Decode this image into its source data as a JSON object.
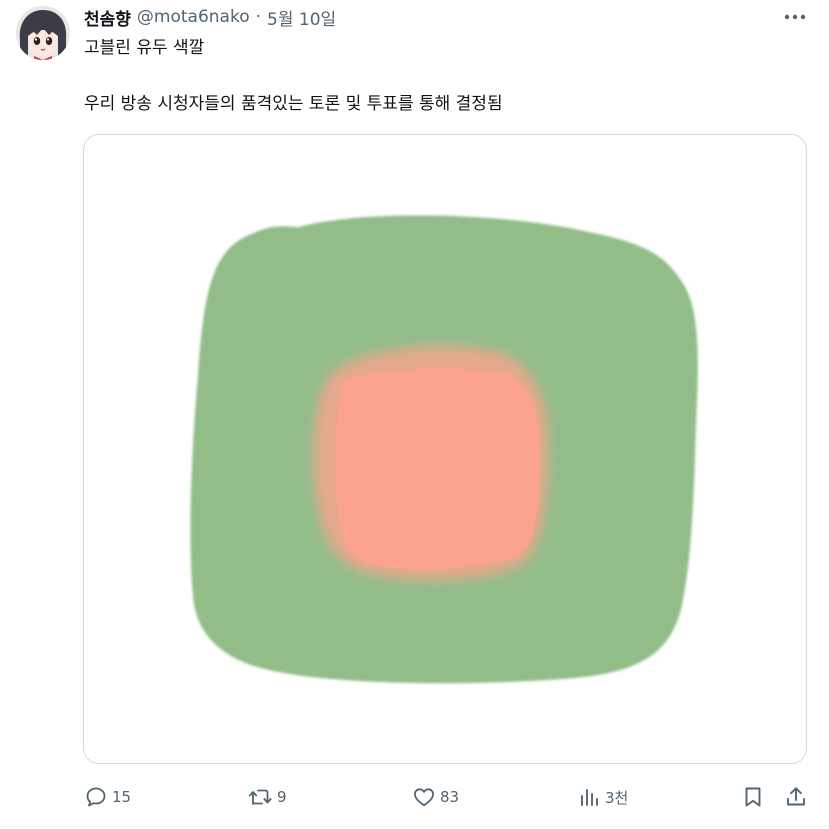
{
  "tweet": {
    "display_name": "천솜향",
    "handle": "@mota6nako",
    "separator": "·",
    "date": "5월 10일",
    "text_line1": "고블린 유두 색깔",
    "text_line2": "우리 방송 시청자들의 품격있는 토론 및 투표를 통해 결정됨"
  },
  "media": {
    "outer_color": "#92bd89",
    "inner_color": "#fba38e",
    "background": "#ffffff"
  },
  "actions": {
    "reply_count": "15",
    "retweet_count": "9",
    "like_count": "83",
    "views_count": "3천"
  },
  "icons": {
    "more": "more-horizontal-icon",
    "reply": "speech-bubble-icon",
    "retweet": "retweet-arrows-icon",
    "like": "heart-icon",
    "views": "bar-chart-icon",
    "bookmark": "bookmark-icon",
    "share": "share-upload-icon"
  },
  "colors": {
    "text_primary": "#0f1419",
    "text_secondary": "#536471",
    "border": "#cfd9de"
  }
}
